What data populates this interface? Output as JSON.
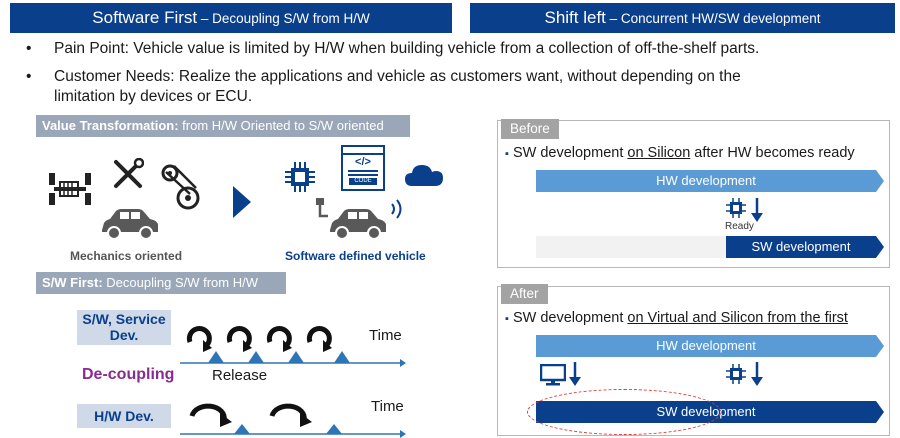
{
  "headers": {
    "left": {
      "big": "Software First",
      "small": " – Decoupling  S/W from H/W"
    },
    "right": {
      "big": "Shift left",
      "small": " – Concurrent HW/SW development"
    }
  },
  "bullets": [
    {
      "dot": "•",
      "text": "Pain Point: Vehicle value is limited by H/W when building vehicle from a collection of off-the-shelf parts."
    },
    {
      "dot": "•",
      "line1": "Customer Needs: Realize the applications and vehicle as customers want, without depending on the",
      "line2": "limitation by devices or ECU."
    }
  ],
  "value_transformation": {
    "bold": "Value Transformation:",
    "rest": " from H/W Oriented to S/W oriented",
    "mechanics_label": "Mechanics oriented",
    "software_label": "Software defined vehicle",
    "code_text": "</>",
    "code_caption": "CODE"
  },
  "sw_first": {
    "bold": "S/W First:",
    "rest": " Decoupling S/W from H/W",
    "service_label_line1": "S/W, Service",
    "service_label_line2": "Dev.",
    "decoupling_label": "De-coupling",
    "hw_label": "H/W Dev.",
    "time_top": "Time",
    "time_bottom": "Time",
    "release": "Release"
  },
  "before": {
    "tag": "Before",
    "bullet": "▪",
    "text_pre": "SW development ",
    "text_u": "on Silicon",
    "text_post": " after HW becomes ready",
    "hw_bar": "HW development",
    "ready": "Ready",
    "sw_bar": "SW development"
  },
  "after": {
    "tag": "After",
    "bullet": "▪",
    "text_pre": "SW development ",
    "text_u": "on Virtual and Silicon from the first",
    "hw_bar": "HW development",
    "sw_bar": "SW development"
  },
  "colors": {
    "navy": "#0a3f8c",
    "light_blue": "#5b9bd5",
    "decoupling_purple": "#8b2a8f",
    "dashed_red": "#e03a3a"
  }
}
